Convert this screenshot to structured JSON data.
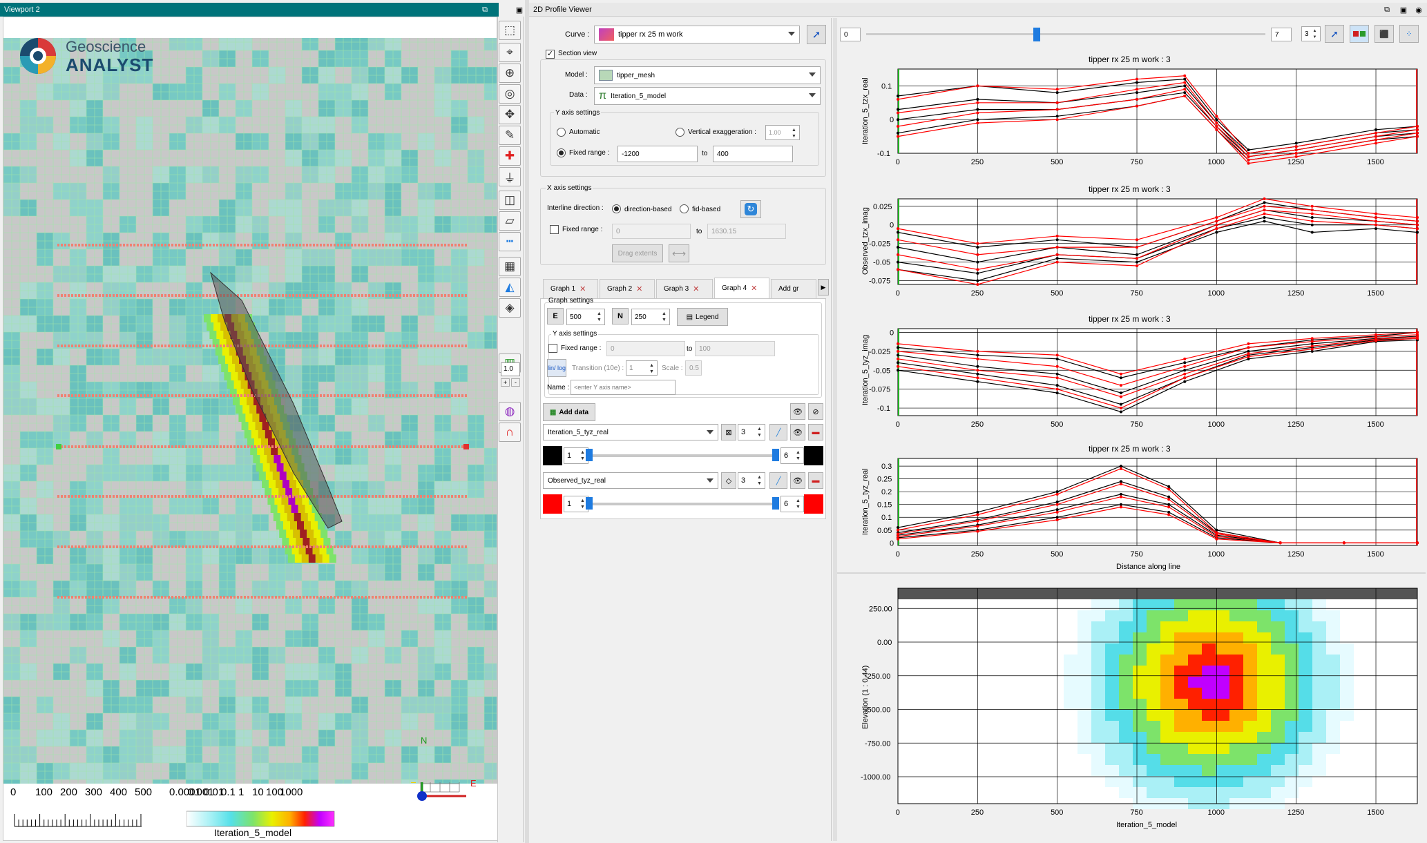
{
  "viewport": {
    "title": "Viewport 2",
    "logo_line1": "Geoscience",
    "logo_line2": "ANALYST",
    "scale_labels": [
      "0",
      "100",
      "200",
      "300",
      "400",
      "500"
    ],
    "colorbar_labels": [
      "0.0001",
      "0.001",
      "0.01",
      "0.1",
      "1",
      "10",
      "100",
      "1000"
    ],
    "colorbar_title": "Iteration_5_model",
    "axis_n": "N",
    "axis_e": "E",
    "zoom_value": "1.0"
  },
  "toolbar": {
    "icons": [
      "select-icon",
      "target-icon",
      "center-icon",
      "focus-icon",
      "pan-icon",
      "pencil-icon",
      "crosshair-icon",
      "filter-icon",
      "box-icon",
      "section-icon",
      "ruler-icon",
      "grid-icon",
      "contour-icon",
      "fill-icon",
      "histogram-icon",
      "camera-icon",
      "globe-icon",
      "magnet-icon"
    ],
    "plus": "+",
    "minus": "-"
  },
  "profile": {
    "title": "2D Profile Viewer",
    "curve_label": "Curve :",
    "curve_value": "tipper rx 25 m work",
    "section_view": "Section view",
    "model_label": "Model :",
    "model_value": "tipper_mesh",
    "data_label": "Data :",
    "data_value": "Iteration_5_model",
    "y_axis_settings": "Y axis settings",
    "automatic": "Automatic",
    "vertical_exaggeration": "Vertical exaggeration :",
    "vert_value": "1.00",
    "fixed_range": "Fixed range :",
    "fixed_min": "-1200",
    "to": "to",
    "fixed_max": "400",
    "x_axis_settings": "X axis settings",
    "interline_direction": "Interline direction :",
    "direction_based": "direction-based",
    "fid_based": "fid-based",
    "x_fixed_range": "Fixed range :",
    "x_min": "0",
    "x_max": "1630.15",
    "drag_extents": "Drag extents",
    "tabs": [
      "Graph 1",
      "Graph 2",
      "Graph 3",
      "Graph 4",
      "Add gr"
    ],
    "graph_settings": "Graph settings",
    "e_label": "E",
    "e_value": "500",
    "n_label": "N",
    "n_value": "250",
    "legend": "Legend",
    "y_axis_settings2": "Y axis settings",
    "fixed_range2": "Fixed range :",
    "fr2_min": "0",
    "fr2_to": "to",
    "fr2_max": "100",
    "linlog": "lin/ log",
    "transition": "Transition (10e) :",
    "transition_val": "1",
    "scale": "Scale :",
    "scale_val": "0.5",
    "name_label": "Name :",
    "name_placeholder": "<enter Y axis name>",
    "add_data": "Add data",
    "series1_name": "Iteration_5_tyz_real",
    "series1_size": "3",
    "series1_min": "1",
    "series1_max": "6",
    "series1_color": "#000000",
    "series2_name": "Observed_tyz_real",
    "series2_size": "3",
    "series2_min": "1",
    "series2_max": "6",
    "series2_color": "#ff0000"
  },
  "charts_top": {
    "slider_min": "0",
    "slider_max": "7",
    "spin_value": "3"
  },
  "chart_data": [
    {
      "type": "line",
      "title": "tipper rx 25 m work : 3",
      "ylabel": "Iteration_5_tzx_real",
      "xlim": [
        0,
        1630
      ],
      "ylim": [
        -0.1,
        0.15
      ],
      "xticks": [
        0,
        250,
        500,
        750,
        1000,
        1250,
        1500
      ],
      "yticks": [
        "0.1",
        "0",
        "-0.1"
      ],
      "ytick_values": [
        0.1,
        0,
        -0.1
      ],
      "series": [
        {
          "color": "#000000",
          "x": [
            0,
            250,
            500,
            750,
            900,
            1000,
            1100,
            1250,
            1500,
            1630
          ],
          "values": [
            0.07,
            0.1,
            0.08,
            0.11,
            0.12,
            0.0,
            -0.09,
            -0.07,
            -0.03,
            -0.02
          ]
        },
        {
          "color": "#000000",
          "x": [
            0,
            250,
            500,
            750,
            900,
            1000,
            1100,
            1250,
            1500,
            1630
          ],
          "values": [
            0.03,
            0.06,
            0.05,
            0.08,
            0.1,
            -0.01,
            -0.1,
            -0.08,
            -0.04,
            -0.03
          ]
        },
        {
          "color": "#000000",
          "x": [
            0,
            250,
            500,
            750,
            900,
            1000,
            1100,
            1250,
            1500,
            1630
          ],
          "values": [
            0.0,
            0.03,
            0.03,
            0.06,
            0.08,
            -0.02,
            -0.11,
            -0.09,
            -0.05,
            -0.04
          ]
        },
        {
          "color": "#000000",
          "x": [
            0,
            250,
            500,
            750,
            900,
            1000,
            1100,
            1250,
            1500,
            1630
          ],
          "values": [
            -0.04,
            0.0,
            0.01,
            0.04,
            0.07,
            -0.03,
            -0.12,
            -0.1,
            -0.06,
            -0.05
          ]
        },
        {
          "color": "#ff0000",
          "x": [
            0,
            250,
            500,
            750,
            900,
            1000,
            1100,
            1250,
            1500,
            1630
          ],
          "values": [
            0.06,
            0.1,
            0.09,
            0.12,
            0.13,
            0.01,
            -0.1,
            -0.08,
            -0.04,
            -0.02
          ]
        },
        {
          "color": "#ff0000",
          "x": [
            0,
            250,
            500,
            750,
            900,
            1000,
            1100,
            1250,
            1500,
            1630
          ],
          "values": [
            0.02,
            0.05,
            0.05,
            0.09,
            0.11,
            -0.01,
            -0.11,
            -0.09,
            -0.05,
            -0.03
          ]
        },
        {
          "color": "#ff0000",
          "x": [
            0,
            250,
            500,
            750,
            900,
            1000,
            1100,
            1250,
            1500,
            1630
          ],
          "values": [
            -0.02,
            0.02,
            0.03,
            0.06,
            0.09,
            -0.02,
            -0.12,
            -0.1,
            -0.06,
            -0.04
          ]
        },
        {
          "color": "#ff0000",
          "x": [
            0,
            250,
            500,
            750,
            900,
            1000,
            1100,
            1250,
            1500,
            1630
          ],
          "values": [
            -0.05,
            -0.01,
            0.0,
            0.04,
            0.07,
            -0.03,
            -0.13,
            -0.11,
            -0.07,
            -0.05
          ]
        }
      ]
    },
    {
      "type": "line",
      "title": "tipper rx 25 m work : 3",
      "ylabel": "Observed_tzx_imag",
      "xlim": [
        0,
        1630
      ],
      "ylim": [
        -0.08,
        0.035
      ],
      "xticks": [
        0,
        250,
        500,
        750,
        1000,
        1250,
        1500
      ],
      "yticks": [
        "0.025",
        "0",
        "-0.025",
        "-0.05",
        "-0.075"
      ],
      "ytick_values": [
        0.025,
        0,
        -0.025,
        -0.05,
        -0.075
      ],
      "series": [
        {
          "color": "#000000",
          "x": [
            0,
            250,
            500,
            750,
            1000,
            1150,
            1300,
            1500,
            1630
          ],
          "values": [
            -0.01,
            -0.03,
            -0.02,
            -0.03,
            0.005,
            0.03,
            0.02,
            0.01,
            0.005
          ]
        },
        {
          "color": "#000000",
          "x": [
            0,
            250,
            500,
            750,
            1000,
            1150,
            1300,
            1500,
            1630
          ],
          "values": [
            -0.03,
            -0.05,
            -0.03,
            -0.04,
            0.0,
            0.02,
            0.01,
            0.005,
            0.0
          ]
        },
        {
          "color": "#000000",
          "x": [
            0,
            250,
            500,
            750,
            1000,
            1150,
            1300,
            1500,
            1630
          ],
          "values": [
            -0.05,
            -0.065,
            -0.04,
            -0.045,
            -0.005,
            0.01,
            0.0,
            0.0,
            -0.005
          ]
        },
        {
          "color": "#000000",
          "x": [
            0,
            250,
            500,
            750,
            1000,
            1150,
            1300,
            1500,
            1630
          ],
          "values": [
            -0.06,
            -0.075,
            -0.045,
            -0.05,
            -0.01,
            0.005,
            -0.01,
            -0.005,
            -0.01
          ]
        },
        {
          "color": "#ff0000",
          "x": [
            0,
            250,
            500,
            750,
            1000,
            1150,
            1300,
            1500,
            1630
          ],
          "values": [
            -0.005,
            -0.025,
            -0.015,
            -0.02,
            0.01,
            0.035,
            0.025,
            0.015,
            0.01
          ]
        },
        {
          "color": "#ff0000",
          "x": [
            0,
            250,
            500,
            750,
            1000,
            1150,
            1300,
            1500,
            1630
          ],
          "values": [
            -0.02,
            -0.04,
            -0.03,
            -0.03,
            0.005,
            0.025,
            0.02,
            0.01,
            0.005
          ]
        },
        {
          "color": "#ff0000",
          "x": [
            0,
            250,
            500,
            750,
            1000,
            1150,
            1300,
            1500,
            1630
          ],
          "values": [
            -0.04,
            -0.06,
            -0.04,
            -0.045,
            0.0,
            0.02,
            0.015,
            0.005,
            0.0
          ]
        },
        {
          "color": "#ff0000",
          "x": [
            0,
            250,
            500,
            750,
            1000,
            1150,
            1300,
            1500,
            1630
          ],
          "values": [
            -0.06,
            -0.08,
            -0.05,
            -0.055,
            -0.005,
            0.015,
            0.005,
            0.0,
            -0.005
          ]
        }
      ]
    },
    {
      "type": "line",
      "title": "tipper rx 25 m work : 3",
      "ylabel": "Iteration_5_tyz_imag",
      "xlim": [
        0,
        1630
      ],
      "ylim": [
        -0.11,
        0.005
      ],
      "xticks": [
        0,
        250,
        500,
        750,
        1000,
        1250,
        1500
      ],
      "yticks": [
        "0",
        "-0.025",
        "-0.05",
        "-0.075",
        "-0.1"
      ],
      "ytick_values": [
        0,
        -0.025,
        -0.05,
        -0.075,
        -0.1
      ],
      "series": [
        {
          "color": "#000000",
          "x": [
            0,
            250,
            500,
            700,
            900,
            1100,
            1300,
            1500,
            1630
          ],
          "values": [
            -0.02,
            -0.03,
            -0.035,
            -0.06,
            -0.04,
            -0.02,
            -0.01,
            -0.005,
            0.0
          ]
        },
        {
          "color": "#000000",
          "x": [
            0,
            250,
            500,
            700,
            900,
            1100,
            1300,
            1500,
            1630
          ],
          "values": [
            -0.03,
            -0.045,
            -0.055,
            -0.08,
            -0.05,
            -0.025,
            -0.015,
            -0.008,
            -0.005
          ]
        },
        {
          "color": "#000000",
          "x": [
            0,
            250,
            500,
            700,
            900,
            1100,
            1300,
            1500,
            1630
          ],
          "values": [
            -0.04,
            -0.055,
            -0.07,
            -0.095,
            -0.06,
            -0.03,
            -0.02,
            -0.01,
            -0.008
          ]
        },
        {
          "color": "#000000",
          "x": [
            0,
            250,
            500,
            700,
            900,
            1100,
            1300,
            1500,
            1630
          ],
          "values": [
            -0.05,
            -0.065,
            -0.08,
            -0.105,
            -0.065,
            -0.035,
            -0.025,
            -0.012,
            -0.01
          ]
        },
        {
          "color": "#ff0000",
          "x": [
            0,
            250,
            500,
            700,
            900,
            1100,
            1300,
            1500,
            1630
          ],
          "values": [
            -0.015,
            -0.025,
            -0.03,
            -0.055,
            -0.035,
            -0.015,
            -0.008,
            -0.003,
            0.0
          ]
        },
        {
          "color": "#ff0000",
          "x": [
            0,
            250,
            500,
            700,
            900,
            1100,
            1300,
            1500,
            1630
          ],
          "values": [
            -0.025,
            -0.035,
            -0.045,
            -0.07,
            -0.045,
            -0.02,
            -0.012,
            -0.006,
            -0.003
          ]
        },
        {
          "color": "#ff0000",
          "x": [
            0,
            250,
            500,
            700,
            900,
            1100,
            1300,
            1500,
            1630
          ],
          "values": [
            -0.035,
            -0.05,
            -0.06,
            -0.085,
            -0.055,
            -0.028,
            -0.018,
            -0.009,
            -0.006
          ]
        },
        {
          "color": "#ff0000",
          "x": [
            0,
            250,
            500,
            700,
            900,
            1100,
            1300,
            1500,
            1630
          ],
          "values": [
            -0.045,
            -0.06,
            -0.075,
            -0.1,
            -0.06,
            -0.032,
            -0.022,
            -0.011,
            -0.008
          ]
        }
      ]
    },
    {
      "type": "line",
      "title": "tipper rx 25 m work : 3",
      "ylabel": "Iteration_5_tyz_real",
      "xlabel": "Distance along line",
      "xlim": [
        0,
        1630
      ],
      "ylim": [
        -0.01,
        0.33
      ],
      "xticks": [
        0,
        250,
        500,
        750,
        1000,
        1250,
        1500
      ],
      "yticks": [
        "0.3",
        "0.25",
        "0.2",
        "0.15",
        "0.1",
        "0.05",
        "0"
      ],
      "ytick_values": [
        0.3,
        0.25,
        0.2,
        0.15,
        0.1,
        0.05,
        0
      ],
      "series": [
        {
          "color": "#000000",
          "x": [
            0,
            250,
            500,
            700,
            850,
            1000,
            1200,
            1400,
            1630
          ],
          "values": [
            0.06,
            0.12,
            0.2,
            0.3,
            0.22,
            0.05,
            0.0,
            0.0,
            0.0
          ]
        },
        {
          "color": "#000000",
          "x": [
            0,
            250,
            500,
            700,
            850,
            1000,
            1200,
            1400,
            1630
          ],
          "values": [
            0.04,
            0.09,
            0.16,
            0.24,
            0.18,
            0.04,
            0.0,
            0.0,
            0.0
          ]
        },
        {
          "color": "#000000",
          "x": [
            0,
            250,
            500,
            700,
            850,
            1000,
            1200,
            1400,
            1630
          ],
          "values": [
            0.03,
            0.07,
            0.13,
            0.19,
            0.15,
            0.03,
            0.0,
            0.0,
            0.0
          ]
        },
        {
          "color": "#000000",
          "x": [
            0,
            250,
            500,
            700,
            850,
            1000,
            1200,
            1400,
            1630
          ],
          "values": [
            0.02,
            0.05,
            0.1,
            0.15,
            0.12,
            0.02,
            0.0,
            0.0,
            0.0
          ]
        },
        {
          "color": "#ff0000",
          "x": [
            0,
            250,
            500,
            700,
            850,
            1000,
            1200,
            1400,
            1630
          ],
          "values": [
            0.05,
            0.11,
            0.19,
            0.29,
            0.21,
            0.04,
            0.0,
            0.0,
            0.0
          ]
        },
        {
          "color": "#ff0000",
          "x": [
            0,
            250,
            500,
            700,
            850,
            1000,
            1200,
            1400,
            1630
          ],
          "values": [
            0.035,
            0.085,
            0.15,
            0.23,
            0.17,
            0.035,
            0.0,
            0.0,
            0.0
          ]
        },
        {
          "color": "#ff0000",
          "x": [
            0,
            250,
            500,
            700,
            850,
            1000,
            1200,
            1400,
            1630
          ],
          "values": [
            0.025,
            0.065,
            0.12,
            0.18,
            0.14,
            0.025,
            0.0,
            0.0,
            0.0
          ]
        },
        {
          "color": "#ff0000",
          "x": [
            0,
            250,
            500,
            700,
            850,
            1000,
            1200,
            1400,
            1630
          ],
          "values": [
            0.015,
            0.045,
            0.09,
            0.14,
            0.11,
            0.015,
            0.0,
            0.0,
            0.0
          ]
        }
      ]
    },
    {
      "type": "heatmap",
      "ylabel": "Elevation (1 : 0.44)",
      "xlabel": "Iteration_5_model",
      "xlim": [
        0,
        1630
      ],
      "ylim": [
        -1200,
        400
      ],
      "xticks": [
        0,
        250,
        500,
        750,
        1000,
        1250,
        1500
      ],
      "yticks": [
        "250.00",
        "0.00",
        "-250.00",
        "-500.00",
        "-750.00",
        "-1000.00"
      ],
      "ytick_values": [
        250,
        0,
        -250,
        -500,
        -750,
        -1000
      ],
      "anomaly_center": [
        980,
        -300
      ]
    }
  ]
}
